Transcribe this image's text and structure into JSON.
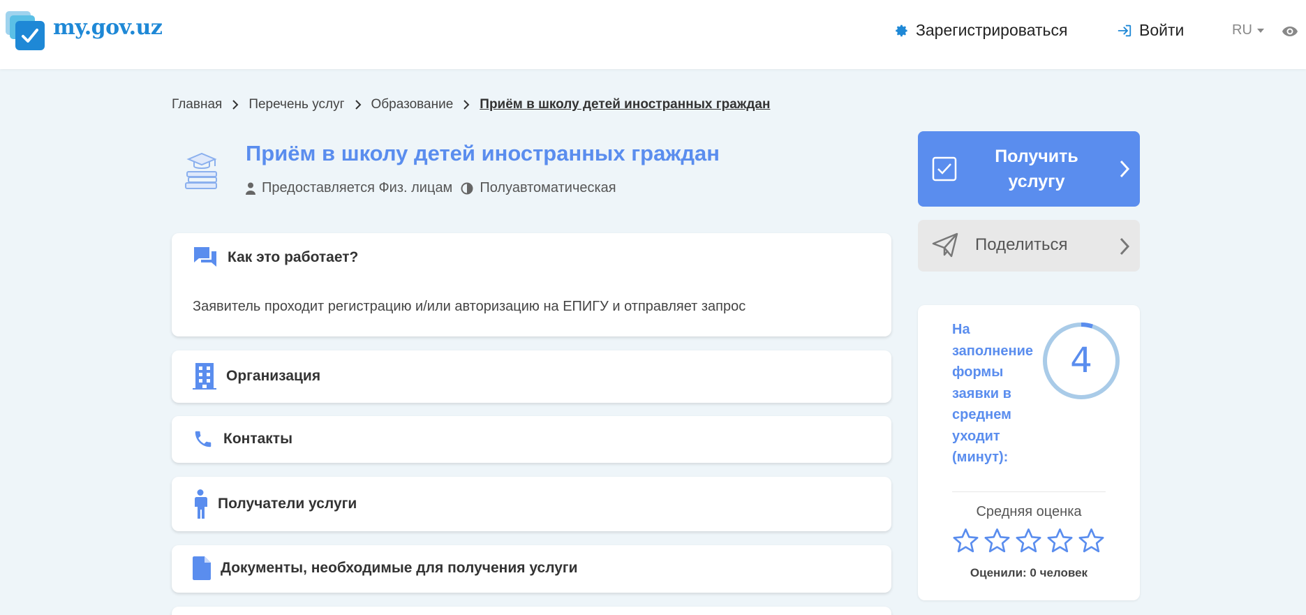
{
  "header": {
    "logo_text": "my.gov.uz",
    "register_label": "Зарегистрироваться",
    "login_label": "Войти",
    "language": "RU"
  },
  "breadcrumb": {
    "items": [
      "Главная",
      "Перечень услуг",
      "Образование"
    ],
    "current": "Приём в школу детей иностранных граждан"
  },
  "service": {
    "title": "Приём в школу детей иностранных граждан",
    "provided_for": "Предоставляется Физ. лицам",
    "mode": "Полуавтоматическая"
  },
  "sections": [
    {
      "title": "Как это работает?",
      "body": "Заявитель проходит регистрацию и/или авторизацию на ЕПИГУ и отправляет запрос"
    },
    {
      "title": "Организация"
    },
    {
      "title": "Контакты"
    },
    {
      "title": "Получатели услуги"
    },
    {
      "title": "Документы, необходимые для получения услуги"
    }
  ],
  "actions": {
    "get_service_label": "Получить услугу",
    "share_label": "Поделиться"
  },
  "stats": {
    "fill_time_label": "На заполнение формы заявки в среднем уходит (минут):",
    "fill_time_value": "4",
    "avg_rating_label": "Средняя оценка",
    "rating": 0,
    "rating_max": 5,
    "rated_count_label": "Оценили: 0 человек"
  },
  "colors": {
    "accent": "#5a8dee",
    "logo_blue": "#1e88d6",
    "ring": "#a9cbe8",
    "background": "#eef5f9"
  }
}
